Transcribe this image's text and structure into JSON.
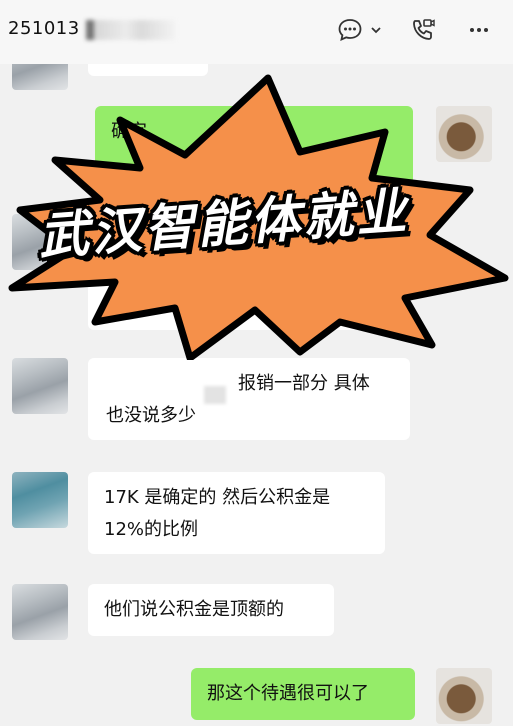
{
  "header": {
    "title": "251013",
    "icons": [
      "chat-bubble-icon",
      "chevron-down-icon",
      "video-call-icon",
      "more-icon"
    ]
  },
  "overlay": {
    "text": "武汉智能体就业",
    "fill_color": "#f5904a",
    "stroke_color": "#000000"
  },
  "messages": [
    {
      "side": "left",
      "lines": [
        ""
      ]
    },
    {
      "side": "right",
      "lines": [
        "确定"
      ]
    },
    {
      "side": "left",
      "lines": [
        "报销一部分 具体",
        "也没说多少"
      ]
    },
    {
      "side": "left",
      "lines": [
        "17K 是确定的 然后公积金是",
        "12%的比例"
      ]
    },
    {
      "side": "left",
      "lines": [
        "他们说公积金是顶额的"
      ]
    },
    {
      "side": "right",
      "lines": [
        "那这个待遇很可以了"
      ]
    }
  ],
  "colors": {
    "sent_bubble": "#95ec69",
    "received_bubble": "#ffffff",
    "chat_background": "#f1f1f1"
  }
}
